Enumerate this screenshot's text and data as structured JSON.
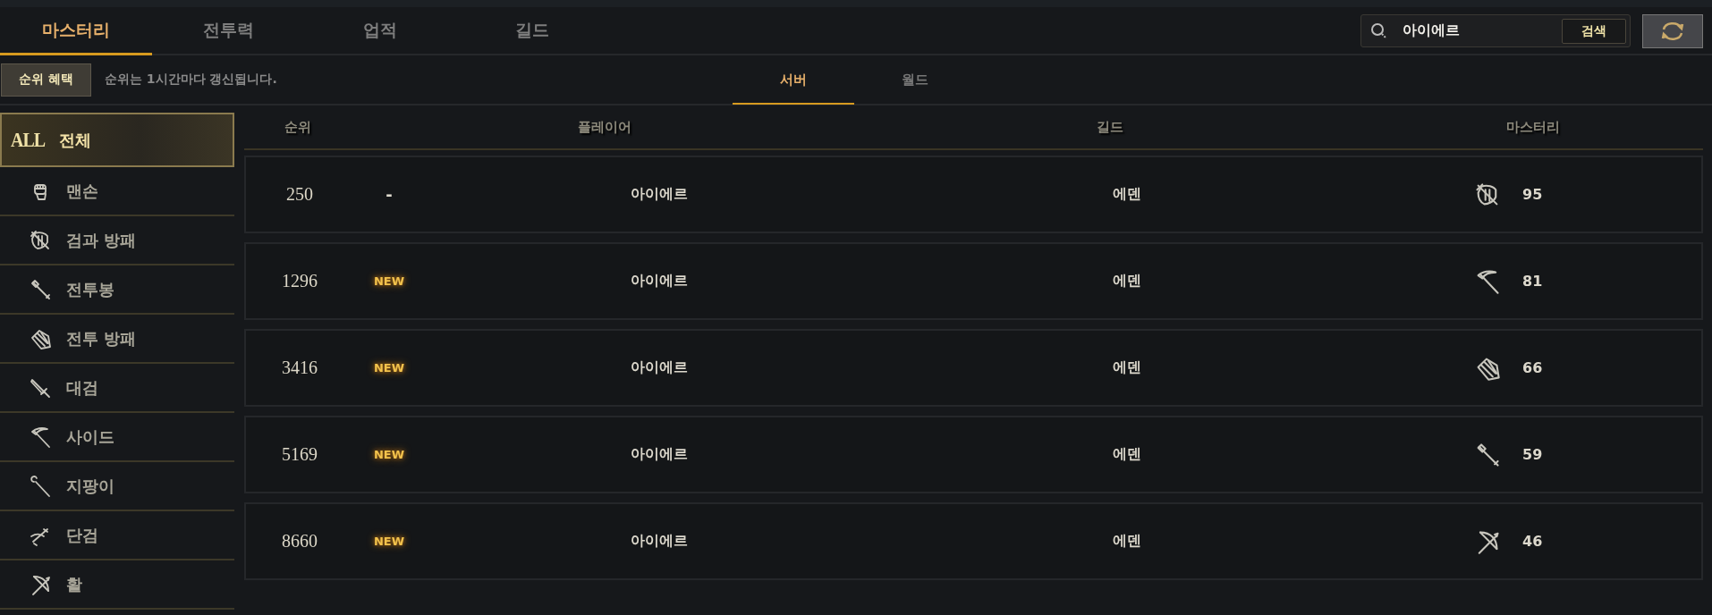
{
  "tabs": [
    {
      "label": "마스터리",
      "selected": true
    },
    {
      "label": "전투력",
      "selected": false
    },
    {
      "label": "업적",
      "selected": false
    },
    {
      "label": "길드",
      "selected": false
    }
  ],
  "search": {
    "value": "아이에르",
    "button": "검색"
  },
  "subbar": {
    "benefit_button": "순위 혜택",
    "notice": "순위는 1시간마다 갱신됩니다.",
    "scope_tabs": [
      {
        "label": "서버",
        "selected": true
      },
      {
        "label": "월드",
        "selected": false
      }
    ]
  },
  "sidebar": {
    "items": [
      {
        "kind": "all",
        "badge": "ALL",
        "label": "전체",
        "selected": true
      },
      {
        "kind": "fist",
        "label": "맨손",
        "selected": false
      },
      {
        "kind": "swordshield",
        "label": "검과 방패",
        "selected": false
      },
      {
        "kind": "staff",
        "label": "전투봉",
        "selected": false
      },
      {
        "kind": "battleshield",
        "label": "전투 방패",
        "selected": false
      },
      {
        "kind": "greatsword",
        "label": "대검",
        "selected": false
      },
      {
        "kind": "scythe",
        "label": "사이드",
        "selected": false
      },
      {
        "kind": "wand",
        "label": "지팡이",
        "selected": false
      },
      {
        "kind": "dagger",
        "label": "단검",
        "selected": false
      },
      {
        "kind": "bow",
        "label": "활",
        "selected": false
      }
    ]
  },
  "table": {
    "columns": [
      "순위",
      "플레이어",
      "길드",
      "마스터리"
    ],
    "rows": [
      {
        "rank": "250",
        "change": "-",
        "is_new": false,
        "player": "아이에르",
        "guild": "에덴",
        "kind": "swordshield",
        "mastery": "95"
      },
      {
        "rank": "1296",
        "change": "NEW",
        "is_new": true,
        "player": "아이에르",
        "guild": "에덴",
        "kind": "scythe",
        "mastery": "81"
      },
      {
        "rank": "3416",
        "change": "NEW",
        "is_new": true,
        "player": "아이에르",
        "guild": "에덴",
        "kind": "battleshield",
        "mastery": "66"
      },
      {
        "rank": "5169",
        "change": "NEW",
        "is_new": true,
        "player": "아이에르",
        "guild": "에덴",
        "kind": "staff",
        "mastery": "59"
      },
      {
        "rank": "8660",
        "change": "NEW",
        "is_new": true,
        "player": "아이에르",
        "guild": "에덴",
        "kind": "bow",
        "mastery": "46"
      }
    ]
  }
}
